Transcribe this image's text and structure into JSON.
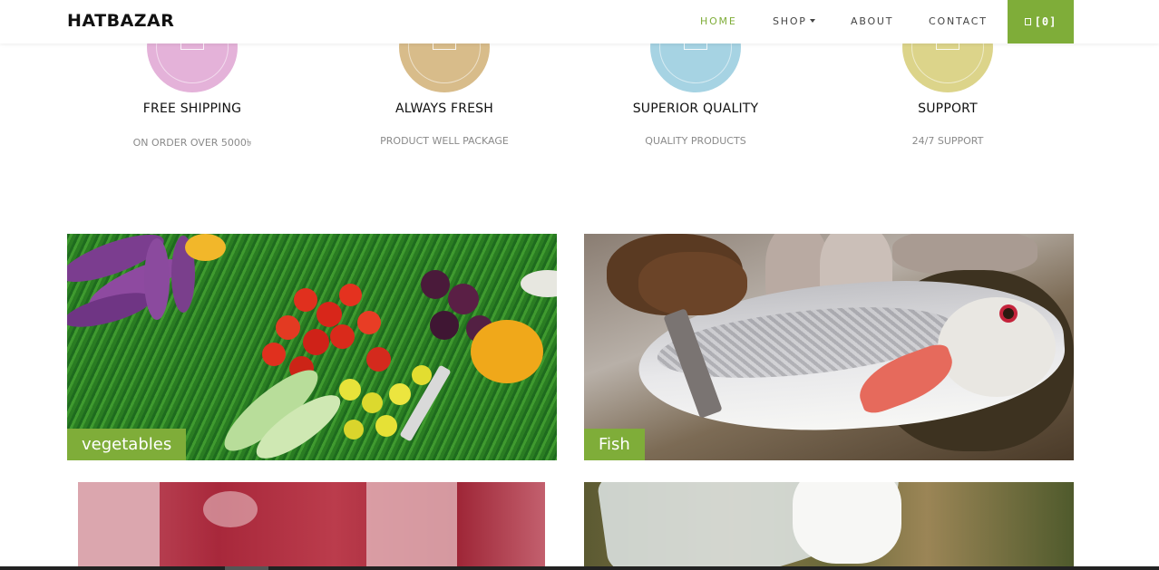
{
  "brand": "HATBAZAR",
  "nav": {
    "items": [
      {
        "label": "HOME",
        "active": true
      },
      {
        "label": "SHOP",
        "has_dropdown": true
      },
      {
        "label": "ABOUT"
      },
      {
        "label": "CONTACT"
      }
    ],
    "cart_label": "[0]",
    "cart_icon": "shopping-cart-icon"
  },
  "features": [
    {
      "title": "FREE SHIPPING",
      "subtitle": "ON ORDER OVER 5000৳",
      "color": "#e4b2d9",
      "icon": "truck-icon"
    },
    {
      "title": "ALWAYS FRESH",
      "subtitle": "PRODUCT WELL PACKAGE",
      "color": "#d8bc8a",
      "icon": "leaf-icon"
    },
    {
      "title": "SUPERIOR QUALITY",
      "subtitle": "QUALITY PRODUCTS",
      "color": "#a6d3e3",
      "icon": "award-icon"
    },
    {
      "title": "SUPPORT",
      "subtitle": "24/7 SUPPORT",
      "color": "#dcd48a",
      "icon": "headset-icon"
    }
  ],
  "categories": [
    {
      "label": "vegetables",
      "image": "vegetables-photo"
    },
    {
      "label": "Fish",
      "image": "fish-photo"
    },
    {
      "label": "",
      "image": "meat-photo"
    },
    {
      "label": "",
      "image": "milk-photo"
    }
  ],
  "colors": {
    "accent": "#7fad39"
  }
}
